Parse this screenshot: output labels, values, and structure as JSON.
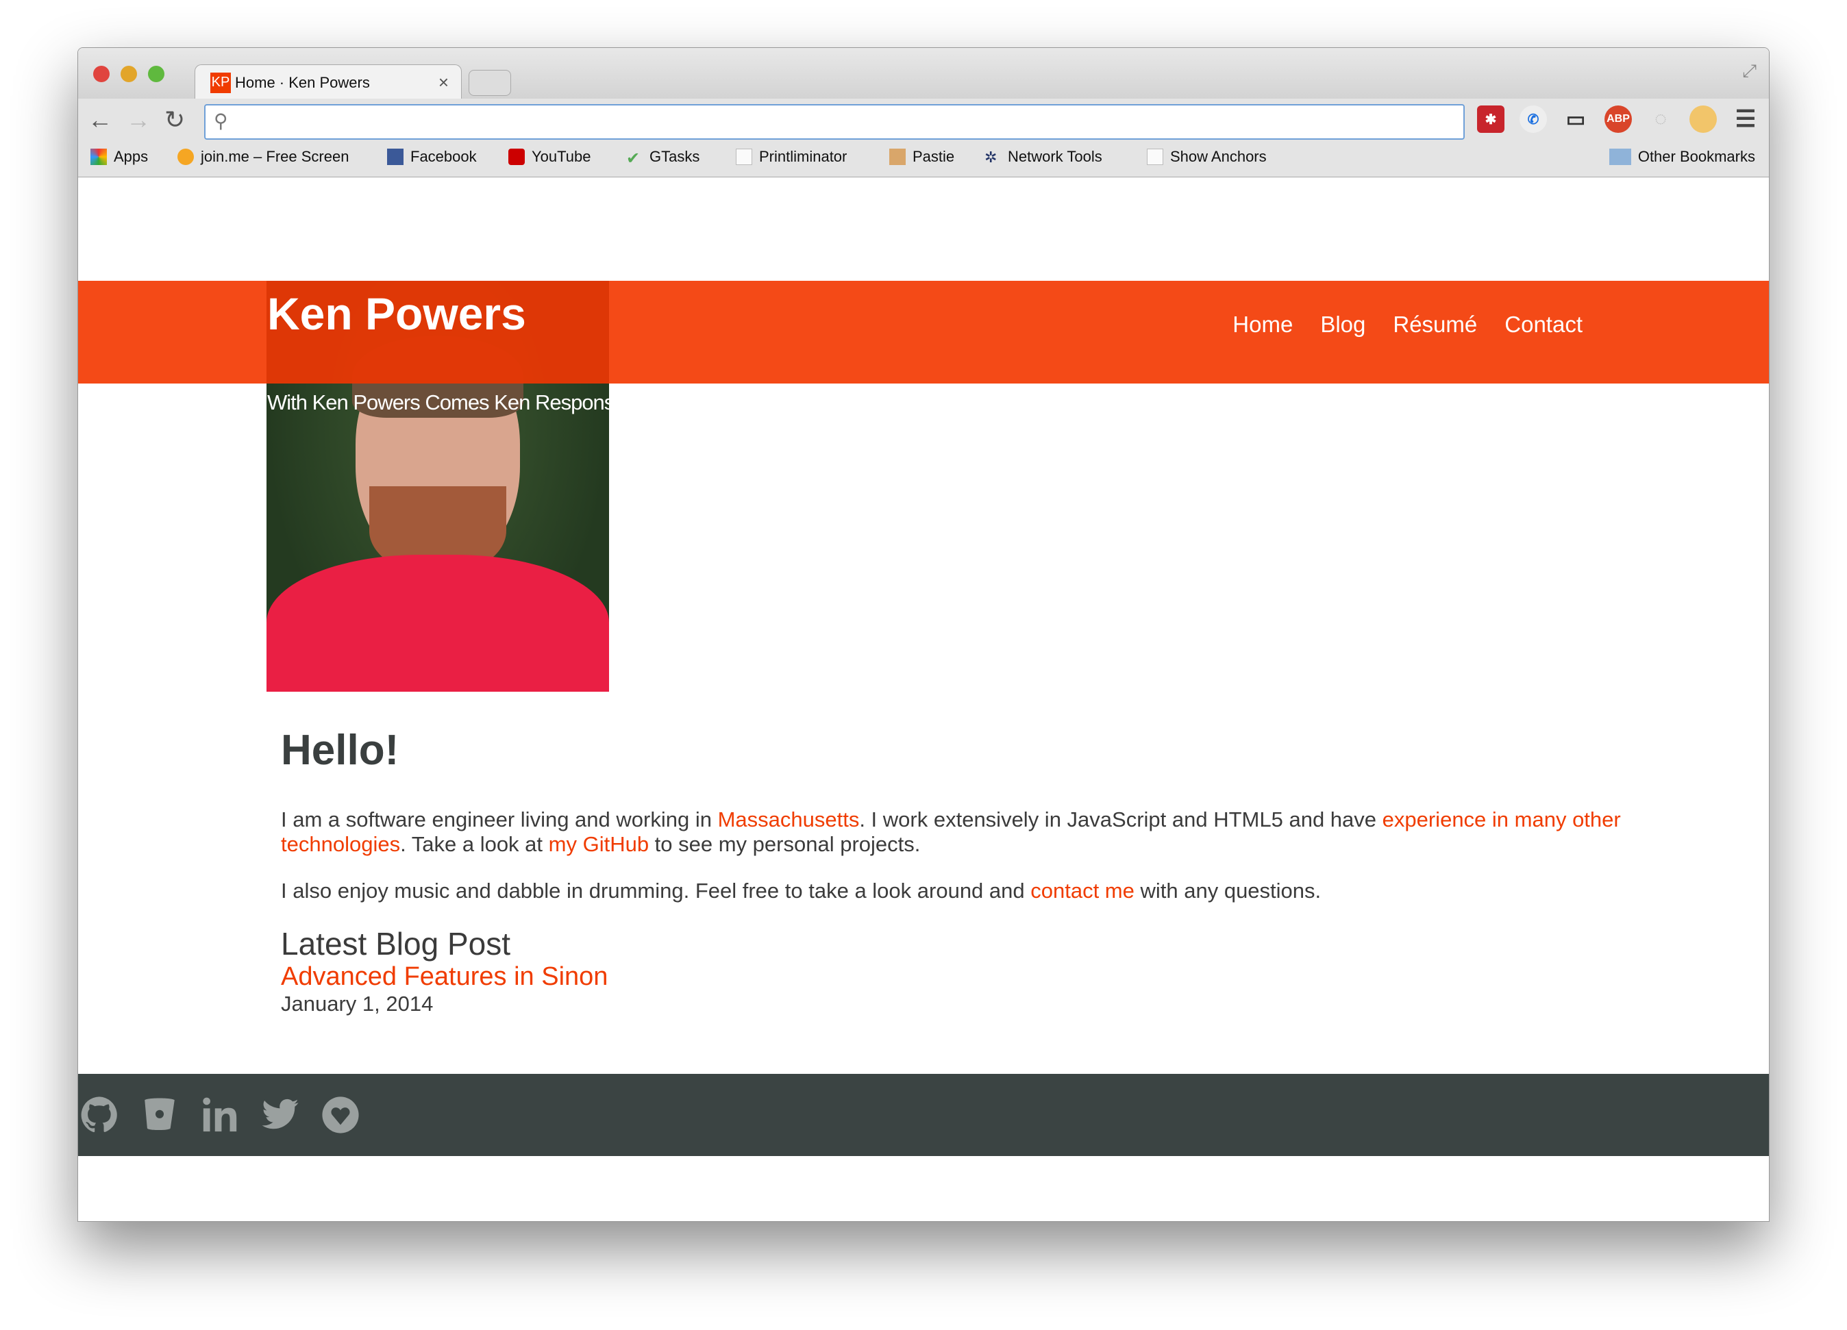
{
  "browser": {
    "tab_title": "Home · Ken Powers",
    "favicon": "KP",
    "address": "",
    "bookmarks": [
      {
        "label": "Apps",
        "icon": "apps-grid-icon"
      },
      {
        "label": "join.me – Free Screen",
        "icon": "joinme-icon"
      },
      {
        "label": "Facebook",
        "icon": "facebook-icon"
      },
      {
        "label": "YouTube",
        "icon": "youtube-icon"
      },
      {
        "label": "GTasks",
        "icon": "checkmark-icon"
      },
      {
        "label": "Printliminator",
        "icon": "page-icon"
      },
      {
        "label": "Pastie",
        "icon": "clipboard-icon"
      },
      {
        "label": "Network Tools",
        "icon": "network-icon"
      },
      {
        "label": "Show Anchors",
        "icon": "page-icon"
      }
    ],
    "other_bookmarks": "Other Bookmarks",
    "extensions": [
      "lastpass-icon",
      "hangouts-icon",
      "cast-icon",
      "adblock-plus-icon",
      "search-ext-icon",
      "puffer-fish-icon",
      "menu-icon"
    ],
    "adblock_label": "ABP"
  },
  "site": {
    "title": "Ken Powers",
    "tagline": "With Ken Powers Comes Ken Responsibility",
    "accent": "#f44a17",
    "footer_color": "#3b4443",
    "nav": [
      "Home",
      "Blog",
      "Résumé",
      "Contact"
    ]
  },
  "main": {
    "heading": "Hello!",
    "p1": {
      "t1": "I am a software engineer living and working in ",
      "l1": "Massachusetts",
      "t2": ". I work extensively in JavaScript and HTML5 and have ",
      "l2": "experience in many other technologies",
      "t3": ". Take a look at ",
      "l3": "my GitHub",
      "t4": " to see my personal projects."
    },
    "p2": {
      "t1": "I also enjoy music and dabble in drumming. Feel free to take a look around and ",
      "l1": "contact me",
      "t2": " with any questions."
    },
    "latest_heading": "Latest Blog Post",
    "post_title": "Advanced Features in Sinon",
    "post_date": "January 1, 2014"
  },
  "footer": {
    "icons": [
      "github-icon",
      "bitbucket-icon",
      "linkedin-icon",
      "twitter-icon",
      "heart-icon"
    ]
  }
}
